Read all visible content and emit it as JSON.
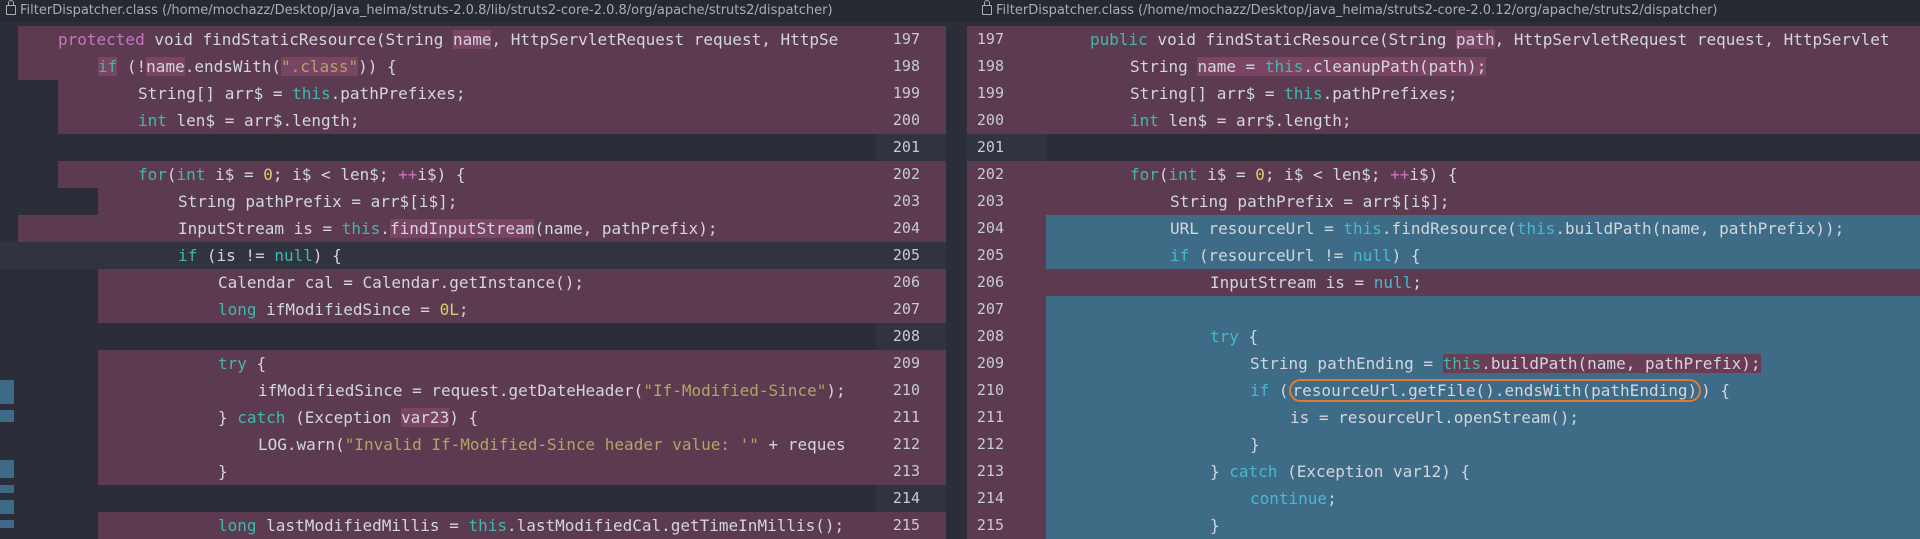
{
  "left_header": "FilterDispatcher.class (/home/mochazz/Desktop/java_heima/struts-2.0.8/lib/struts2-core-2.0.8/org/apache/struts2/dispatcher)",
  "right_header": "FilterDispatcher.class (/home/mochazz/Desktop/java_heima/struts2-core-2.0.12/org/apache/struts2/dispatcher)",
  "line_numbers": [
    "197",
    "198",
    "199",
    "200",
    "201",
    "202",
    "203",
    "204",
    "205",
    "206",
    "207",
    "208",
    "209",
    "210",
    "211",
    "212",
    "213",
    "214",
    "215"
  ],
  "left_code": [
    [
      "protected",
      " void findStaticResource(String ",
      "name",
      ", HttpServletRequest request, HttpSe"
    ],
    [
      "if",
      " (!",
      "name",
      ".endsWith(",
      "\".class\"",
      ")) {"
    ],
    [
      "String[] arr$ = ",
      "this",
      ".pathPrefixes;"
    ],
    [
      "int",
      " len$ = arr$.length;"
    ],
    [
      ""
    ],
    [
      "for",
      "(",
      "int",
      " i$ = ",
      "0",
      "; i$ < len$; ",
      "++",
      "i$) {"
    ],
    [
      "String pathPrefix = arr$[i$];"
    ],
    [
      "InputStream is = ",
      "this",
      ".",
      "findInputStream",
      "(name, pathPrefix);"
    ],
    [
      "if",
      " (is != ",
      "null",
      ") {"
    ],
    [
      "Calendar cal = Calendar.getInstance();"
    ],
    [
      "long",
      " ifModifiedSince = ",
      "0L",
      ";"
    ],
    [
      ""
    ],
    [
      "try",
      " {"
    ],
    [
      "ifModifiedSince = request.getDateHeader(",
      "\"If-Modified-Since\"",
      ");"
    ],
    [
      "} ",
      "catch",
      " (Exception ",
      "var23",
      ") {"
    ],
    [
      "LOG.warn(",
      "\"Invalid If-Modified-Since header value: '\"",
      " + reques"
    ],
    [
      "}"
    ],
    [
      ""
    ],
    [
      "long",
      " lastModifiedMillis = ",
      "this",
      ".lastModifiedCal.getTimeInMillis();"
    ]
  ],
  "right_code": [
    [
      "public",
      " void findStaticResource(String ",
      "path",
      ", HttpServletRequest request, HttpServlet"
    ],
    [
      "String ",
      "name",
      " = ",
      "this",
      ".cleanupPath(path);"
    ],
    [
      "String[] arr$ = ",
      "this",
      ".pathPrefixes;"
    ],
    [
      "int",
      " len$ = arr$.length;"
    ],
    [
      ""
    ],
    [
      "for",
      "(",
      "int",
      " i$ = ",
      "0",
      "; i$ < len$; ",
      "++",
      "i$) {"
    ],
    [
      "String pathPrefix = arr$[i$];"
    ],
    [
      "URL resourceUrl = ",
      "this",
      ".findResource(",
      "this",
      ".buildPath(name, pathPrefix));"
    ],
    [
      "if",
      " (resourceUrl != ",
      "null",
      ") {"
    ],
    [
      "InputStream is = ",
      "null",
      ";"
    ],
    [
      ""
    ],
    [
      "try",
      " {"
    ],
    [
      "String pathEnding = ",
      "this",
      ".",
      "buildPath",
      "(name, pathPrefix);"
    ],
    [
      "if",
      " (",
      "resourceUrl.getFile().endsWith(pathEnding)",
      ") {"
    ],
    [
      "is = resourceUrl.openStream();"
    ],
    [
      "}"
    ],
    [
      "} ",
      "catch",
      " (Exception var12) {"
    ],
    [
      "continue",
      ";"
    ],
    [
      "}"
    ]
  ]
}
